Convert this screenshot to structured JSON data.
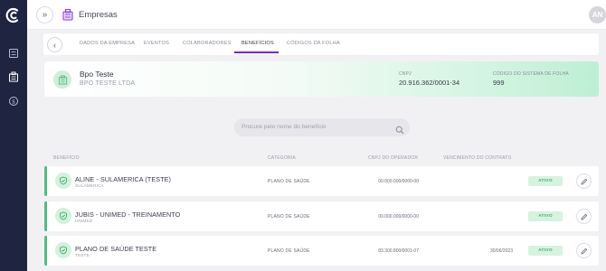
{
  "colors": {
    "sidebar": "#1f2440",
    "accent": "#7b22d4",
    "success": "#4cc07c"
  },
  "sidebar": {
    "items": [
      {
        "icon": "list-icon"
      },
      {
        "icon": "building-icon"
      },
      {
        "icon": "money-icon"
      }
    ]
  },
  "header": {
    "title": "Empresas",
    "avatar_initials": "AN"
  },
  "tabs": [
    {
      "label": "DADOS DA EMPRESA",
      "active": false
    },
    {
      "label": "EVENTOS",
      "active": false
    },
    {
      "label": "COLABORADORES",
      "active": false
    },
    {
      "label": "BENEFÍCIOS",
      "active": true
    },
    {
      "label": "CÓDIGOS DA FOLHA",
      "active": false
    }
  ],
  "company": {
    "name": "Bpo Teste",
    "legal_name": "BPO TESTE LTDA",
    "cnpj_label": "CNPJ",
    "cnpj": "20.916.362/0001-34",
    "payroll_code_label": "CÓDIGO DO SISTEMA DE FOLHA",
    "payroll_code": "999"
  },
  "search": {
    "placeholder": "Procure pelo nome do benefício"
  },
  "columns": {
    "benefit": "BENEFÍCIO",
    "category": "CATEGORIA",
    "operator_cnpj": "CNPJ DO OPERADOR",
    "contract_due": "VENCIMENTO DO CONTRATO"
  },
  "benefits": [
    {
      "name": "ALINE - SULAMERICA (TESTE)",
      "operator": "SULAMERICA",
      "category": "PLANO DE SAÚDE",
      "cnpj": "00.000.000/0000-00",
      "due": "",
      "status": "ATIVO"
    },
    {
      "name": "JUBIS - UNIMED - TREINAMENTO",
      "operator": "UNIMED",
      "category": "PLANO DE SAÚDE",
      "cnpj": "00.000.000/0000-00",
      "due": "",
      "status": "ATIVO"
    },
    {
      "name": "PLANO DE SAÚDE TESTE",
      "operator": "TESTE",
      "category": "PLANO DE SAÚDE",
      "cnpj": "83.300.800/0001-07",
      "due": "30/06/2023",
      "status": "ATIVO"
    }
  ]
}
